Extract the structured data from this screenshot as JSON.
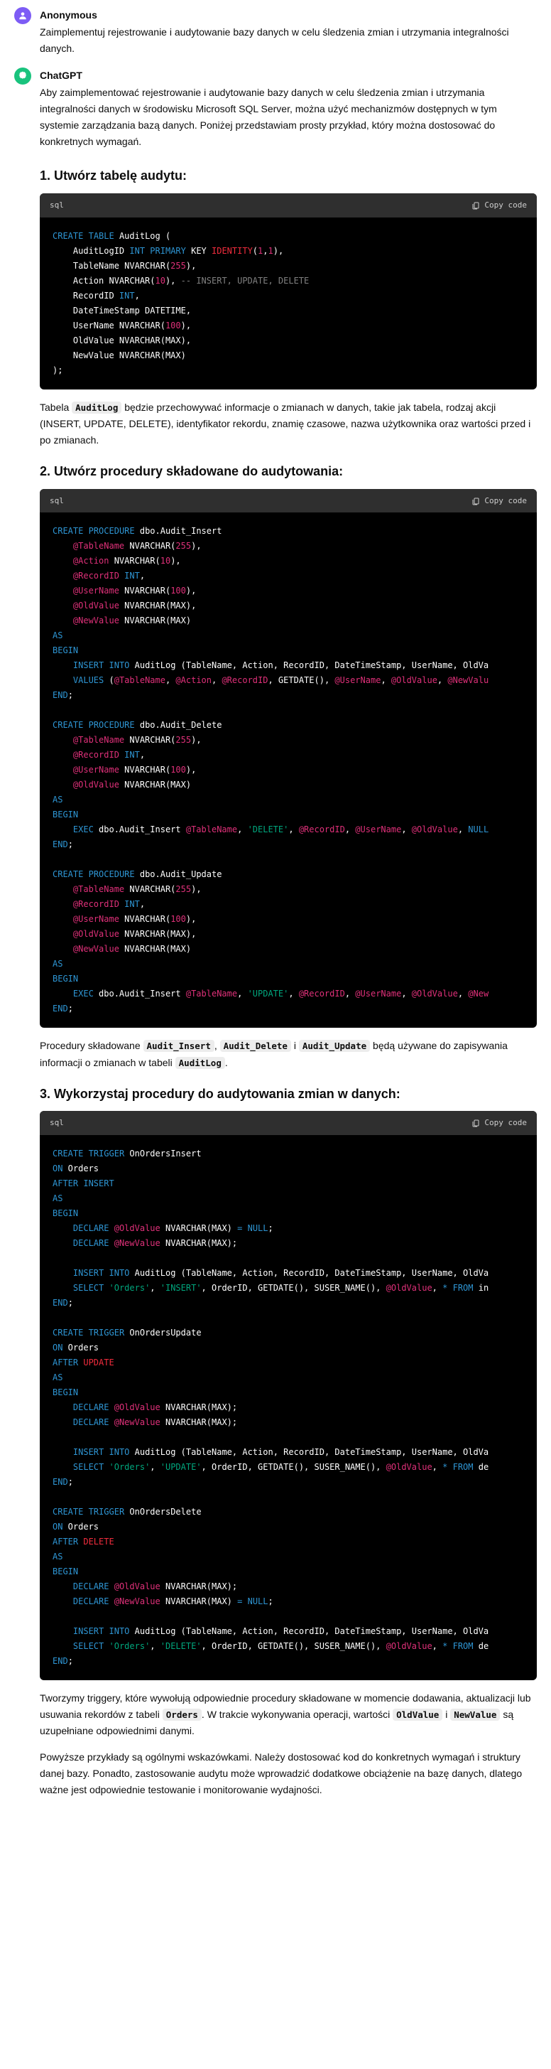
{
  "user": {
    "author": "Anonymous",
    "text": "Zaimplementuj rejestrowanie i audytowanie bazy danych w celu śledzenia zmian i utrzymania integralności danych."
  },
  "gpt": {
    "author": "ChatGPT",
    "intro": "Aby zaimplementować rejestrowanie i audytowanie bazy danych w celu śledzenia zmian i utrzymania integralności danych w środowisku Microsoft SQL Server, można użyć mechanizmów dostępnych w tym systemie zarządzania bazą danych. Poniżej przedstawiam prosty przykład, który można dostosować do konkretnych wymagań."
  },
  "h1": "1. Utwórz tabelę audytu:",
  "h2": "2. Utwórz procedury składowane do audytowania:",
  "h3": "3. Wykorzystaj procedury do audytowania zmian w danych:",
  "code_lang": "sql",
  "copy_label": "Copy code",
  "p1a": "Tabela ",
  "p1code": "AuditLog",
  "p1b": " będzie przechowywać informacje o zmianach w danych, takie jak tabela, rodzaj akcji (INSERT, UPDATE, DELETE), identyfikator rekordu, znamię czasowe, nazwa użytkownika oraz wartości przed i po zmianach.",
  "p2a": "Procedury składowane ",
  "p2c1": "Audit_Insert",
  "p2s1": ", ",
  "p2c2": "Audit_Delete",
  "p2s2": " i ",
  "p2c3": "Audit_Update",
  "p2b": " będą używane do zapisywania informacji o zmianach w tabeli ",
  "p2c4": "AuditLog",
  "p2end": ".",
  "p3a": "Tworzymy triggery, które wywołują odpowiednie procedury składowane w momencie dodawania, aktualizacji lub usuwania rekordów z tabeli ",
  "p3c1": "Orders",
  "p3b": ". W trakcie wykonywania operacji, wartości ",
  "p3c2": "OldValue",
  "p3s": " i ",
  "p3c3": "NewValue",
  "p3c": " są uzupełniane odpowiednimi danymi.",
  "p4": "Powyższe przykłady są ogólnymi wskazówkami. Należy dostosować kod do konkretnych wymagań i struktury danej bazy. Ponadto, zastosowanie audytu może wprowadzić dodatkowe obciążenie na bazę danych, dlatego ważne jest odpowiednie testowanie i monitorowanie wydajności."
}
